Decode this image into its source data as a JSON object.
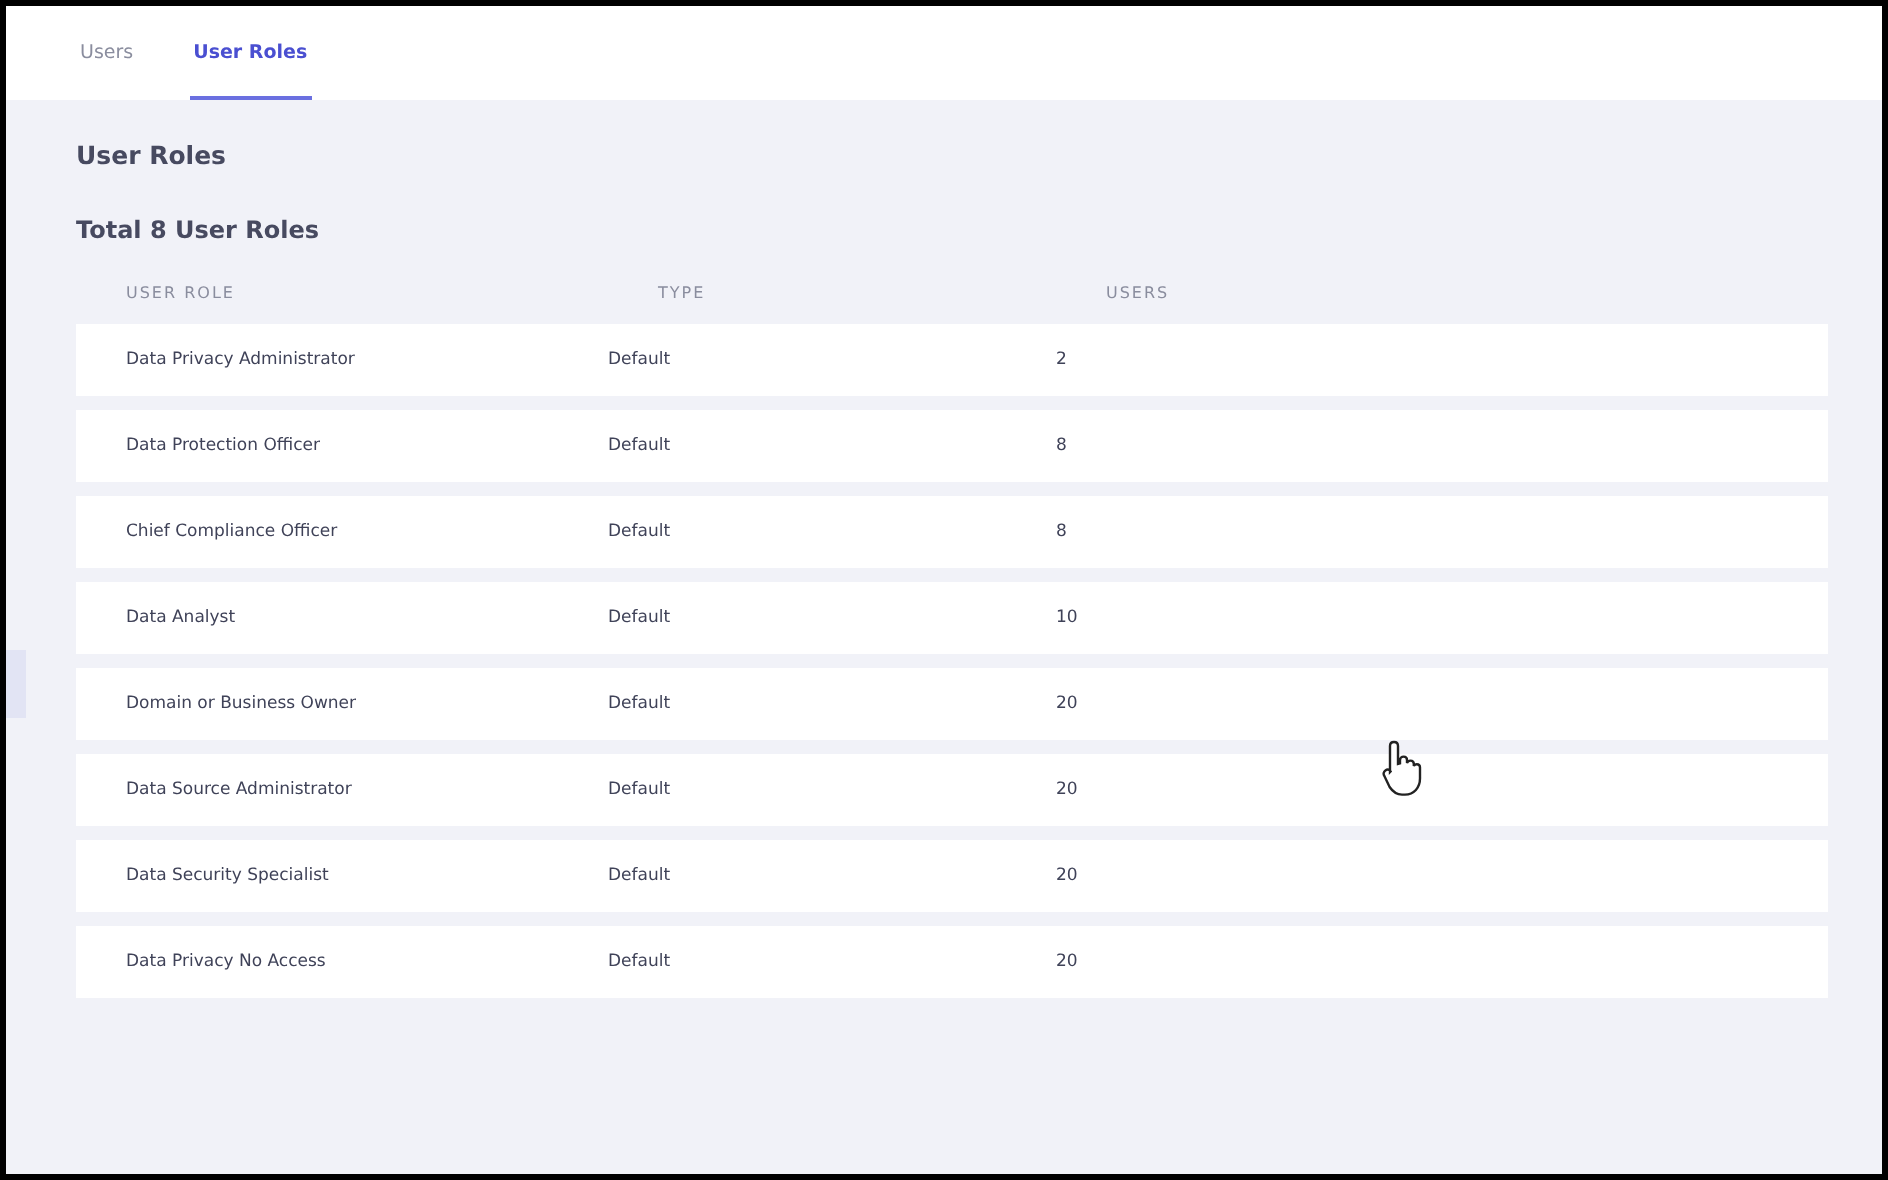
{
  "tabs": [
    {
      "label": "Users",
      "selected": false
    },
    {
      "label": "User Roles",
      "selected": true
    }
  ],
  "page_title": "User Roles",
  "total_label": "Total 8 User Roles",
  "table": {
    "columns": [
      "USER ROLE",
      "TYPE",
      "USERS"
    ],
    "rows": [
      {
        "role": "Data Privacy Administrator",
        "type": "Default",
        "users": "2"
      },
      {
        "role": "Data Protection Officer",
        "type": "Default",
        "users": "8"
      },
      {
        "role": "Chief Compliance Officer",
        "type": "Default",
        "users": "8"
      },
      {
        "role": "Data Analyst",
        "type": "Default",
        "users": "10"
      },
      {
        "role": "Domain or Business Owner",
        "type": "Default",
        "users": "20"
      },
      {
        "role": "Data Source Administrator",
        "type": "Default",
        "users": "20"
      },
      {
        "role": "Data Security Specialist",
        "type": "Default",
        "users": "20"
      },
      {
        "role": "Data Privacy No Access",
        "type": "Default",
        "users": "20"
      }
    ]
  }
}
